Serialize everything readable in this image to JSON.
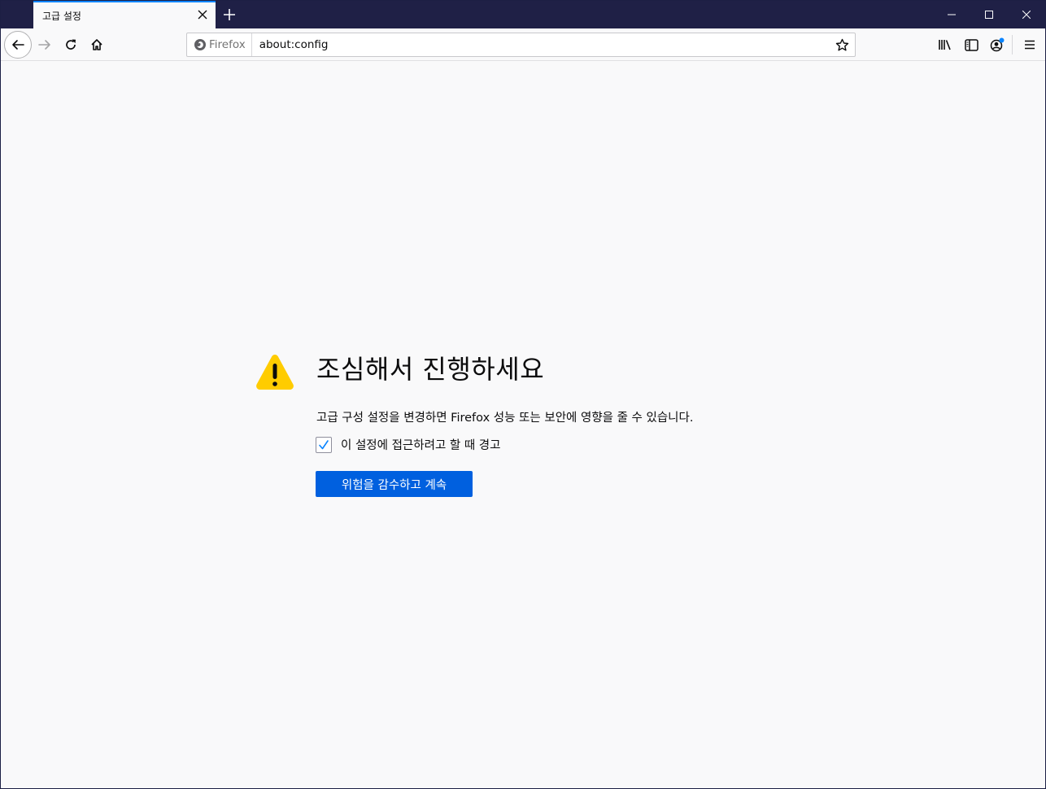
{
  "browser": {
    "tab": {
      "title": "고급 설정"
    },
    "urlbar": {
      "identity_label": "Firefox",
      "url": "about:config"
    },
    "icons": {
      "back": "back-arrow-icon",
      "forward": "forward-arrow-icon",
      "reload": "reload-icon",
      "home": "home-icon",
      "bookmark": "star-icon",
      "library": "library-icon",
      "sidebar": "sidebar-icon",
      "account": "account-icon",
      "menu": "hamburger-menu-icon"
    },
    "colors": {
      "titlebar": "#1f2046",
      "tab_accent": "#0a84ff",
      "notification_dot": "#0a84ff"
    }
  },
  "page": {
    "title": "조심해서 진행하세요",
    "description": "고급 구성 설정을 변경하면 Firefox 성능 또는 보안에 영향을 줄 수 있습니다.",
    "checkbox": {
      "label": "이 설정에 접근하려고 할 때 경고",
      "checked": true
    },
    "accept_button": "위험을 감수하고 계속",
    "colors": {
      "warning": "#ffcc00",
      "button": "#0060df"
    }
  }
}
